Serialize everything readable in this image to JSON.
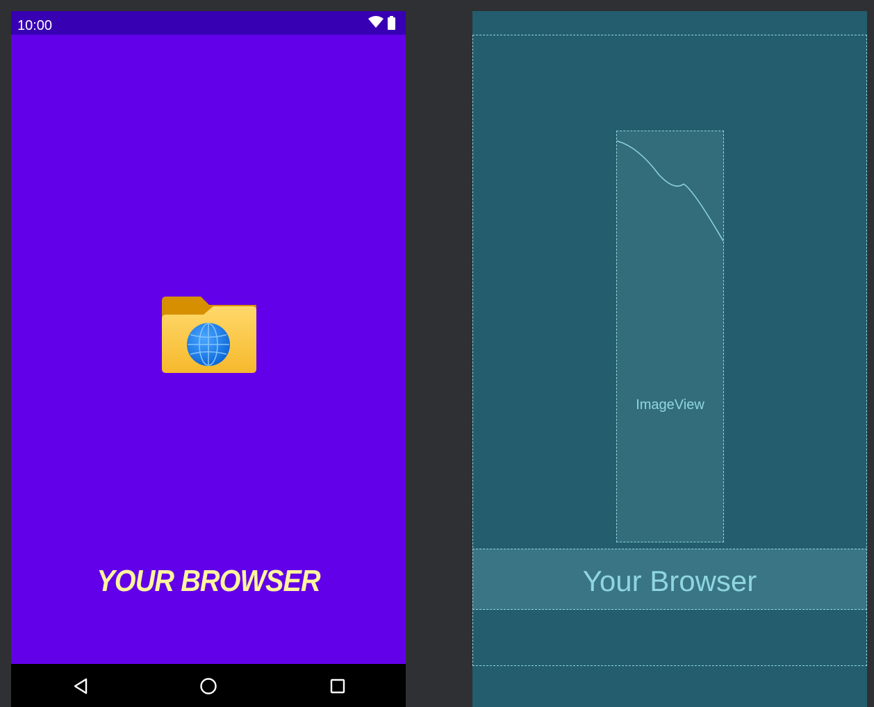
{
  "design": {
    "status_bar": {
      "time": "10:00",
      "icons": [
        "wifi-icon",
        "battery-icon"
      ]
    },
    "app_icon": "folder-globe-icon",
    "brand_title": "YOUR BROWSER",
    "nav_bar": {
      "buttons": [
        "back-icon",
        "home-icon",
        "recents-icon"
      ]
    }
  },
  "blueprint": {
    "image_view_label": "ImageView",
    "text_view_label": "Your Browser"
  },
  "colors": {
    "primary": "#6200ea",
    "primary_dark": "#3700b3",
    "title_text": "#fff59d",
    "blueprint_bg": "#235d6e",
    "blueprint_line": "#8fd6e0"
  }
}
